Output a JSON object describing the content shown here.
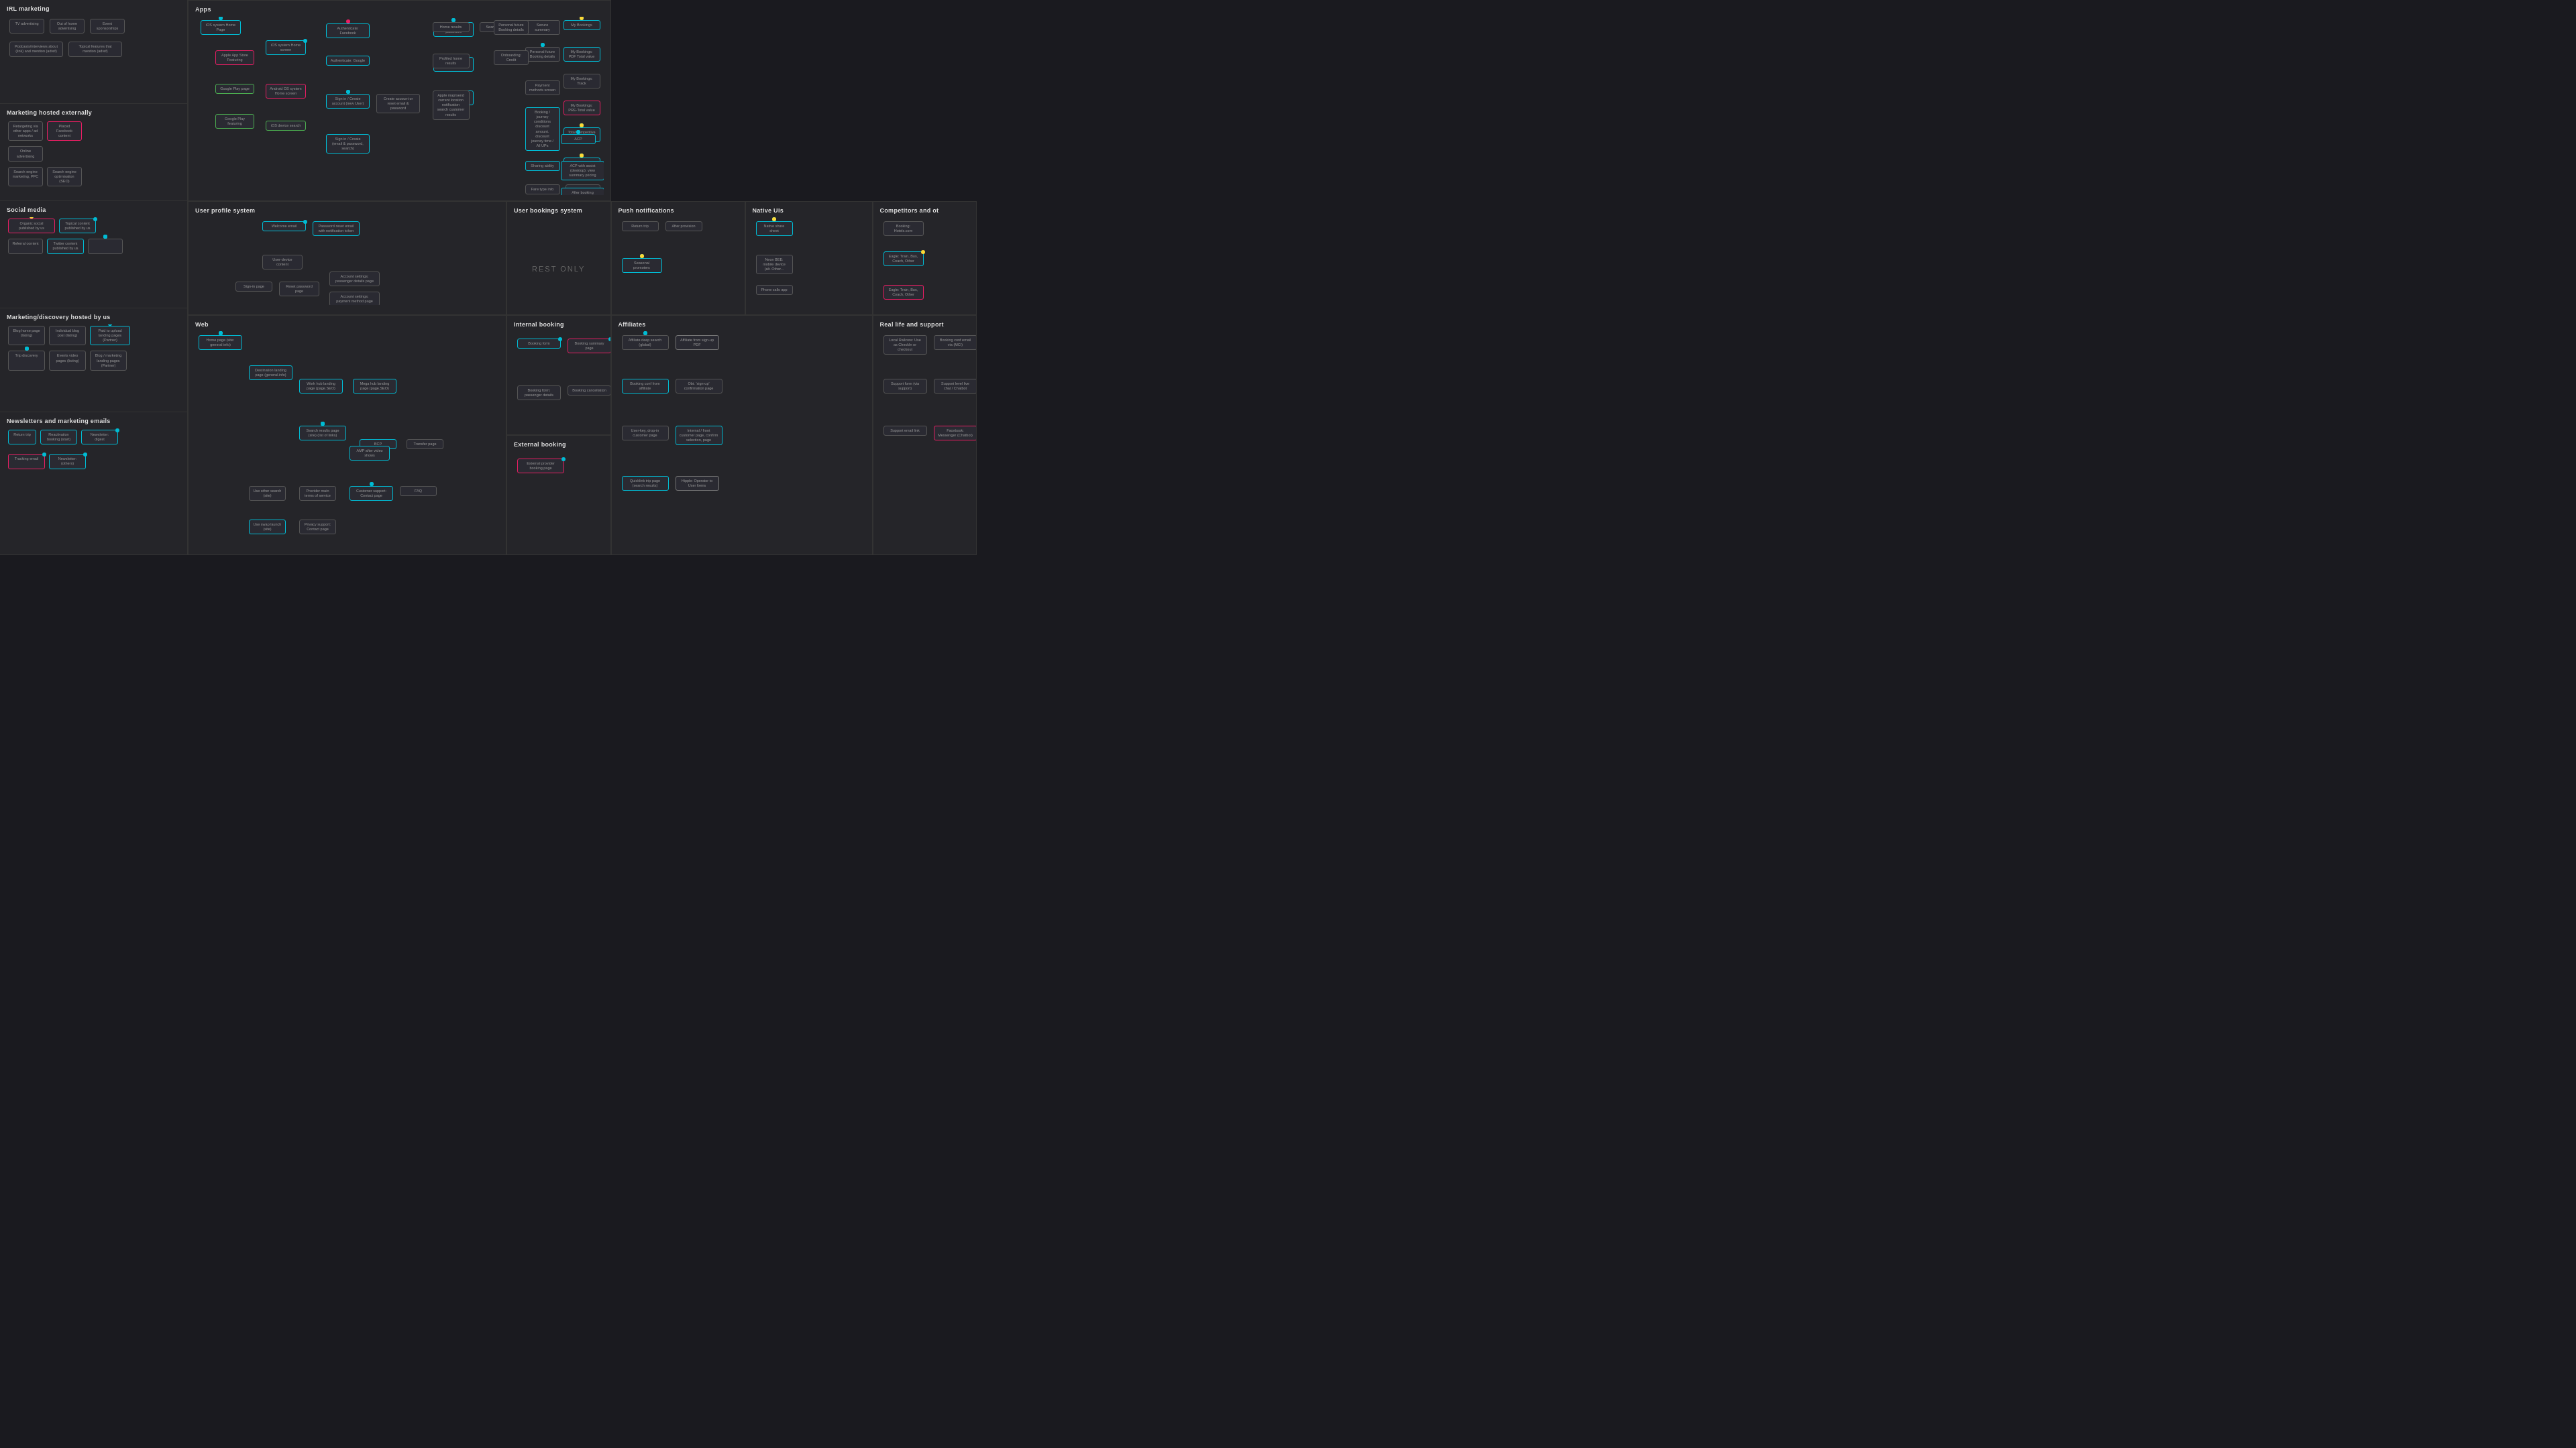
{
  "sections": {
    "irl": {
      "title": "IRL marketing"
    },
    "marketing_ext": {
      "title": "Marketing hosted externally"
    },
    "social": {
      "title": "Social media"
    },
    "marketing_hosted": {
      "title": "Marketing/discovery hosted by us"
    },
    "newsletters": {
      "title": "Newsletters and marketing emails"
    },
    "apps": {
      "title": "Apps"
    },
    "user_profile": {
      "title": "User profile system"
    },
    "user_bookings": {
      "title": "User bookings system"
    },
    "push": {
      "title": "Push notifications"
    },
    "native": {
      "title": "Native UIs"
    },
    "competitors": {
      "title": "Competitors and ot"
    },
    "web": {
      "title": "Web"
    },
    "internal_booking": {
      "title": "Internal booking"
    },
    "external_booking": {
      "title": "External booking"
    },
    "affiliates": {
      "title": "Affiliates"
    },
    "real_life": {
      "title": "Real life and support"
    }
  },
  "user_bookings": {
    "rest_only": "REST ONLY"
  }
}
